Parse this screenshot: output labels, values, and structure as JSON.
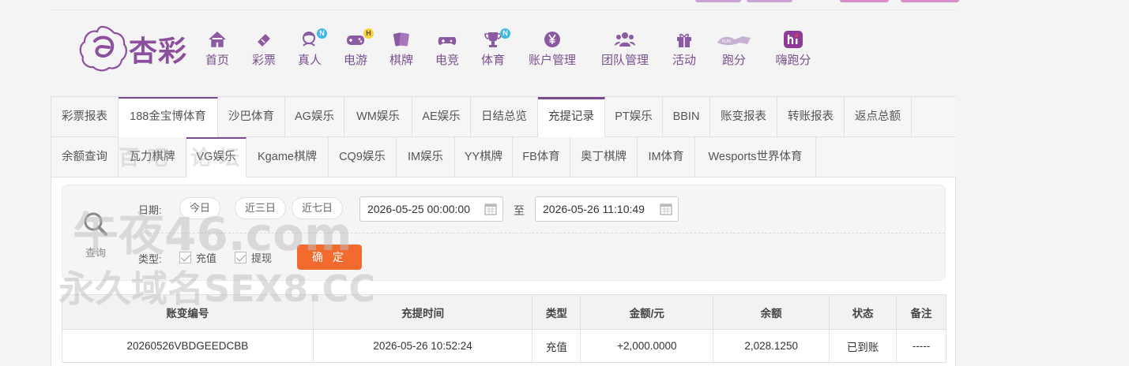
{
  "brand": {
    "name": "杏彩",
    "color": "#8c4f9e"
  },
  "nav": [
    {
      "label": "首页",
      "icon": "home-icon"
    },
    {
      "label": "彩票",
      "icon": "ticket-icon"
    },
    {
      "label": "真人",
      "icon": "dealer-icon",
      "badge": "N"
    },
    {
      "label": "电游",
      "icon": "gamepad-icon",
      "badge": "H"
    },
    {
      "label": "棋牌",
      "icon": "cards-icon"
    },
    {
      "label": "电竞",
      "icon": "controller-icon"
    },
    {
      "label": "体育",
      "icon": "trophy-icon",
      "badge": "N"
    },
    {
      "label": "账户管理",
      "icon": "yen-icon"
    },
    {
      "label": "团队管理",
      "icon": "team-icon"
    },
    {
      "label": "活动",
      "icon": "gift-icon"
    },
    {
      "label": "跑分",
      "icon": "running-icon"
    },
    {
      "label": "嗨跑分",
      "icon": "hi-icon"
    }
  ],
  "tabs_row1": [
    "彩票报表",
    "188金宝博体育",
    "沙巴体育",
    "AG娱乐",
    "WM娱乐",
    "AE娱乐",
    "日结总览",
    "充提记录",
    "PT娱乐",
    "BBIN",
    "账变报表",
    "转账报表",
    "返点总额"
  ],
  "tabs_row2": [
    "余额查询",
    "瓦力棋牌",
    "VG娱乐",
    "Kgame棋牌",
    "CQ9娱乐",
    "IM娱乐",
    "YY棋牌",
    "FB体育",
    "奥丁棋牌",
    "IM体育",
    "Wesports世界体育"
  ],
  "active_tab": "充提记录",
  "filter": {
    "search_label": "查询",
    "date_label": "日期:",
    "quick": [
      "今日",
      "近三日",
      "近七日"
    ],
    "start": "2026-05-25 00:00:00",
    "to": "至",
    "end": "2026-05-26 11:10:49",
    "type_label": "类型:",
    "types": [
      "充值",
      "提现"
    ],
    "confirm": "确 定"
  },
  "table": {
    "headers": [
      "账变编号",
      "充提时间",
      "类型",
      "金额/元",
      "余额",
      "状态",
      "备注"
    ],
    "rows": [
      [
        "20260526VBDGEEDCBB",
        "2026-05-26 10:52:24",
        "充值",
        "+2,000.0000",
        "2,028.1250",
        "已到账",
        "-----"
      ]
    ]
  },
  "watermark": {
    "line1": "午夜46.com",
    "line2": "永久域名SEX8.CC",
    "tag": "百吧   论坛"
  },
  "colors": {
    "accent": "#7b4d8e",
    "confirm": "#f26a2e",
    "amount": "#c0201f",
    "status_ok": "#3b9a36"
  }
}
